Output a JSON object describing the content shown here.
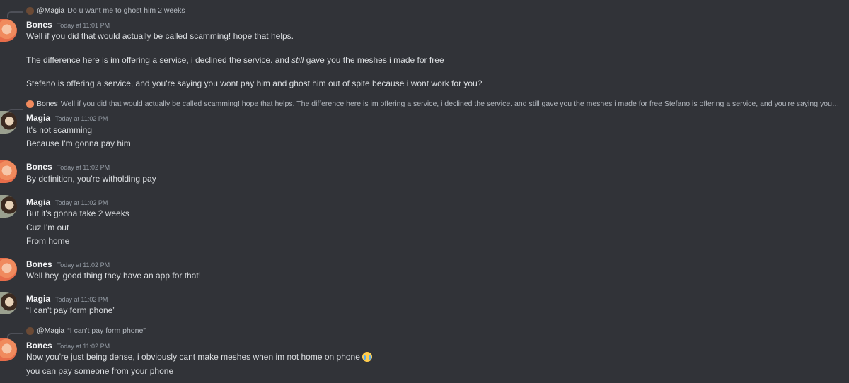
{
  "messages": {
    "g1": {
      "reply": {
        "name": "@Magia",
        "text": "Do u want me to ghost him 2 weeks"
      },
      "author": "Bones",
      "timestamp": "Today at 11:01 PM",
      "line1": "Well if you did that would actually be called scamming! hope that helps.",
      "line2_pre": "The difference here is im offering a service, i declined the service. and ",
      "line2_em": "still",
      "line2_post": " gave you the meshes i made for free",
      "line3": "Stefano is offering a service, and you're saying you wont pay him and ghost him out of spite because i wont work for you?"
    },
    "g2": {
      "reply": {
        "name": "Bones",
        "text": "Well if you did that would actually be called scamming! hope that helps.  The difference here is im offering a service, i declined the service. and still gave you the meshes i made for free  Stefano is offering a service, and you're saying you wont pay hi..."
      },
      "author": "Magia",
      "timestamp": "Today at 11:02 PM",
      "line1": "It's not scamming",
      "line2": "Because I'm gonna pay him"
    },
    "g3": {
      "author": "Bones",
      "timestamp": "Today at 11:02 PM",
      "line1": "By definition, you're witholding pay"
    },
    "g4": {
      "author": "Magia",
      "timestamp": "Today at 11:02 PM",
      "line1": "But it's gonna take 2 weeks",
      "line2": "Cuz I'm out",
      "line3": "From home"
    },
    "g5": {
      "author": "Bones",
      "timestamp": "Today at 11:02 PM",
      "line1": "Well hey, good thing they have an app for that!"
    },
    "g6": {
      "author": "Magia",
      "timestamp": "Today at 11:02 PM",
      "line1": "“I can't pay form phone”"
    },
    "g7": {
      "reply": {
        "name": "@Magia",
        "text": "“I can't pay form phone”"
      },
      "author": "Bones",
      "timestamp": "Today at 11:02 PM",
      "line1": "Now you're just being dense, i obviously cant make meshes when im not home on phone",
      "line2": "you can pay someone from your phone"
    }
  },
  "icons": {
    "emoji": "loudly-crying-face-icon"
  }
}
